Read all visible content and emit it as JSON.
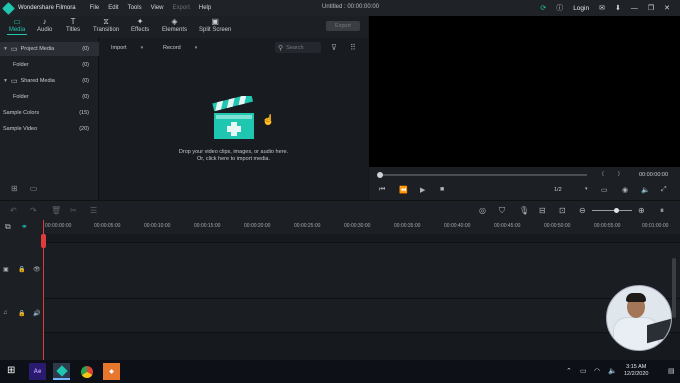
{
  "titlebar": {
    "app_name": "Wondershare Filmora",
    "menu": [
      "File",
      "Edit",
      "Tools",
      "View",
      "Export",
      "Help"
    ],
    "project_title": "Untitled : 00:00:00:00",
    "login_label": "Login"
  },
  "tabs": [
    {
      "label": "Media",
      "icon": "folder-icon",
      "active": true
    },
    {
      "label": "Audio",
      "icon": "music-note-icon",
      "active": false
    },
    {
      "label": "Titles",
      "icon": "text-icon",
      "active": false
    },
    {
      "label": "Transition",
      "icon": "transition-icon",
      "active": false
    },
    {
      "label": "Effects",
      "icon": "sparkle-icon",
      "active": false
    },
    {
      "label": "Elements",
      "icon": "shapes-icon",
      "active": false
    },
    {
      "label": "Split Screen",
      "icon": "split-screen-icon",
      "active": false
    }
  ],
  "export_label": "Export",
  "library": [
    {
      "label": "Project Media",
      "count": "(0)"
    },
    {
      "label": "Folder",
      "count": "(0)"
    },
    {
      "label": "Shared Media",
      "count": "(0)"
    },
    {
      "label": "Folder",
      "count": "(0)"
    },
    {
      "label": "Sample Colors",
      "count": "(15)"
    },
    {
      "label": "Sample Video",
      "count": "(20)"
    }
  ],
  "media": {
    "import_label": "Import",
    "record_label": "Record",
    "search_placeholder": "Search",
    "drop_line1": "Drop your video clips, images, or audio here.",
    "drop_line2": "Or, click here to import media."
  },
  "preview": {
    "timecode": "00:00:00:00",
    "quality": "1/2",
    "mark_in": "{",
    "mark_out": "}"
  },
  "ruler_ticks": [
    "00:00:00:00",
    "00:00:05:00",
    "00:00:10:00",
    "00:00:15:00",
    "00:00:20:00",
    "00:00:25:00",
    "00:00:30:00",
    "00:00:35:00",
    "00:00:40:00",
    "00:00:45:00",
    "00:00:50:00",
    "00:00:55:00",
    "00:01:00:00"
  ],
  "taskbar": {
    "apps": [
      {
        "name": "ae-app",
        "label": "Ae",
        "color": "#2b1b6e"
      },
      {
        "name": "filmora-app",
        "label": "",
        "color": "#1fc7b1"
      },
      {
        "name": "chrome-app",
        "label": "",
        "color": "#e6b12a"
      },
      {
        "name": "orange-app",
        "label": "",
        "color": "#e8772e"
      }
    ],
    "time": "3:15 AM",
    "date": "12/2/2020"
  }
}
